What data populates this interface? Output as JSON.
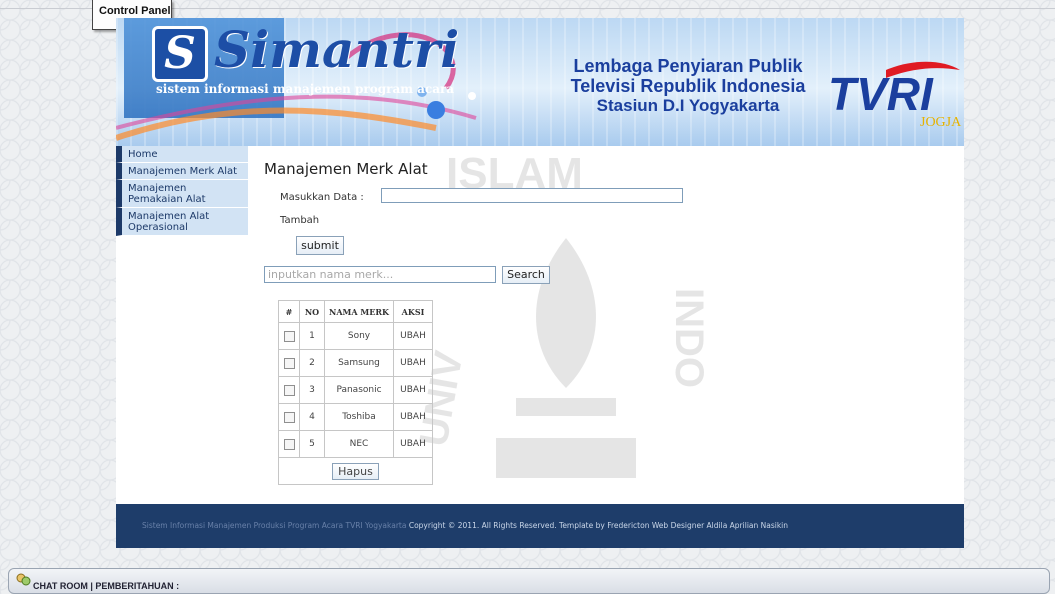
{
  "control_panel": {
    "label": "Control Panel"
  },
  "banner": {
    "app_title": "Simantri",
    "app_subtitle": "sistem informasi manajemen program acara",
    "org_line1": "Lembaga Penyiaran Publik",
    "org_line2": "Televisi Republik Indonesia",
    "org_line3": "Stasiun D.I Yogyakarta",
    "tvri_logo_text": "TVRI",
    "tvri_logo_sub": "JOGJA"
  },
  "sidebar": {
    "items": [
      {
        "label": "Home"
      },
      {
        "label": "Manajemen Merk Alat"
      },
      {
        "label": "Manajemen Pemakaian Alat"
      },
      {
        "label": "Manajemen Alat Operasional"
      }
    ]
  },
  "main": {
    "title": "Manajemen Merk Alat",
    "form_label": "Masukkan Data :",
    "form_value": "",
    "tambah_label": "Tambah",
    "submit_label": "submit",
    "search_placeholder": "inputkan nama merk...",
    "search_label": "Search"
  },
  "table": {
    "headers": [
      "#",
      "NO",
      "NAMA MERK",
      "AKSI"
    ],
    "rows": [
      {
        "no": "1",
        "name": "Sony",
        "action": "UBAH"
      },
      {
        "no": "2",
        "name": "Samsung",
        "action": "UBAH"
      },
      {
        "no": "3",
        "name": "Panasonic",
        "action": "UBAH"
      },
      {
        "no": "4",
        "name": "Toshiba",
        "action": "UBAH"
      },
      {
        "no": "5",
        "name": "NEC",
        "action": "UBAH"
      }
    ],
    "hapus_label": "Hapus"
  },
  "footer": {
    "left_text": "Sistem Informasi Manajemen Produksi Program Acara TVRI Yogyakarta",
    "right_text": "Copyright © 2011. All Rights Reserved. Template by Fredericton Web Designer Aldila Aprilian Nasikin"
  },
  "chat_bar": {
    "label": "CHAT ROOM | PEMBERITAHUAN :"
  },
  "colors": {
    "nav_item_bg": "#d2e3f4",
    "nav_border": "#1c3968",
    "footer_bg": "#1e3d6a",
    "banner_title": "#1b3f9e",
    "tvri_red": "#e01b23"
  }
}
